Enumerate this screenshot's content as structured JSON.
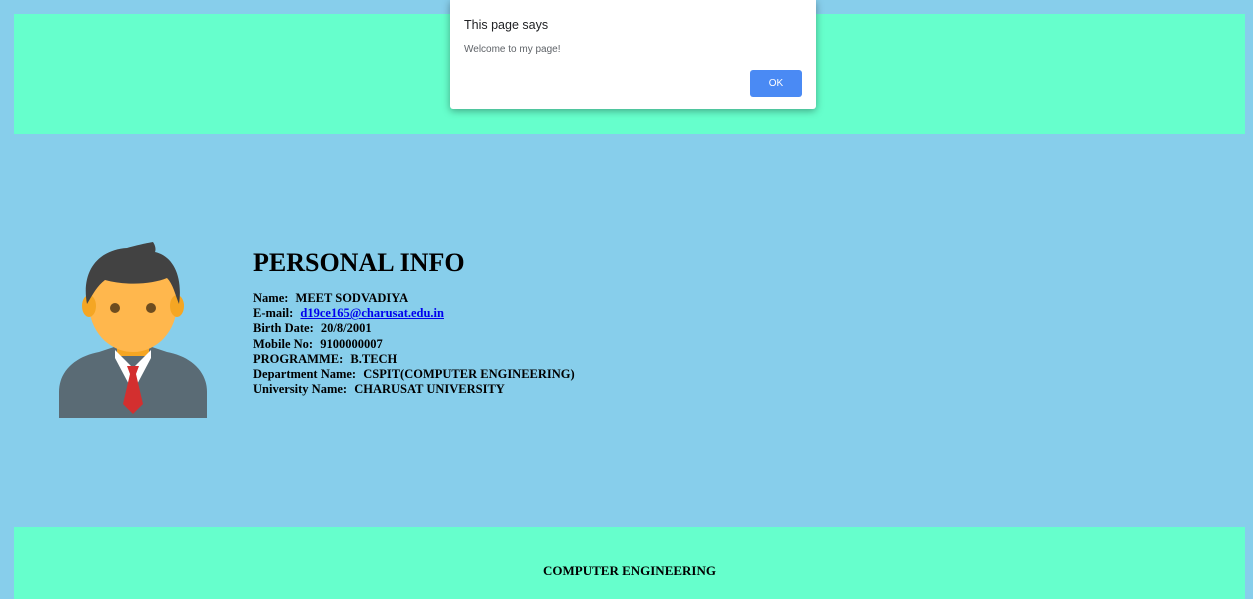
{
  "dialog": {
    "title": "This page says",
    "message": "Welcome to my page!",
    "ok_label": "OK"
  },
  "profile": {
    "title": "PERSONAL INFO",
    "fields": [
      {
        "label": "Name:",
        "value": "MEET SODVADIYA"
      },
      {
        "label": "E-mail:",
        "value": "d19ce165@charusat.edu.in"
      },
      {
        "label": "Birth Date:",
        "value": "20/8/2001"
      },
      {
        "label": "Mobile No:",
        "value": "9100000007"
      },
      {
        "label": "PROGRAMME:",
        "value": "B.TECH"
      },
      {
        "label": "Department Name:",
        "value": "CSPIT(COMPUTER ENGINEERING)"
      },
      {
        "label": "University Name:",
        "value": "CHARUSAT UNIVERSITY"
      }
    ]
  },
  "footer": {
    "text": "COMPUTER ENGINEERING"
  },
  "colors": {
    "page_background": "#87ceeb",
    "band_background": "#66ffcc",
    "ok_button": "#4a8af4",
    "link": "#0000ee"
  },
  "icons": {
    "avatar": "businessman-avatar-icon"
  }
}
